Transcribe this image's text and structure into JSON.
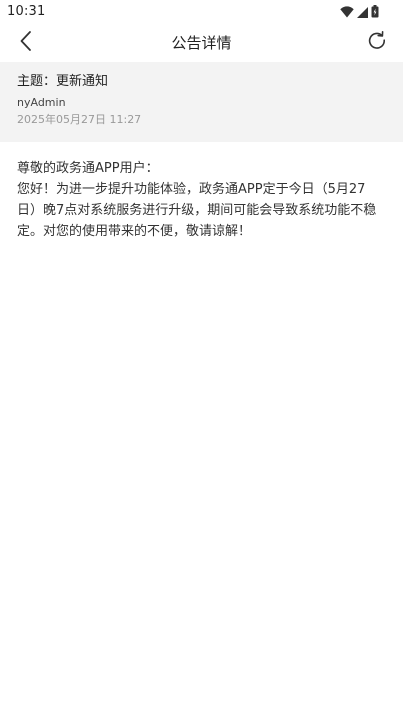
{
  "status_bar": {
    "time": "10:31",
    "icons": [
      "wifi-icon",
      "signal-icon",
      "battery-icon"
    ]
  },
  "nav": {
    "title": "公告详情",
    "back_icon": "chevron-left-icon",
    "refresh_icon": "refresh-icon"
  },
  "notice": {
    "subject": "主题：更新通知",
    "author": "nyAdmin",
    "date": "2025年05月27日 11:27",
    "greeting": "尊敬的政务通APP用户：",
    "body": "您好！为进一步提升功能体验，政务通APP定于今日（5月27日）晚7点对系统服务进行升级，期间可能会导致系统功能不稳定。对您的使用带来的不便，敬请谅解！"
  },
  "colors": {
    "header_background": "#f3f3f3",
    "date_text": "#999999",
    "body_text": "#333333"
  }
}
